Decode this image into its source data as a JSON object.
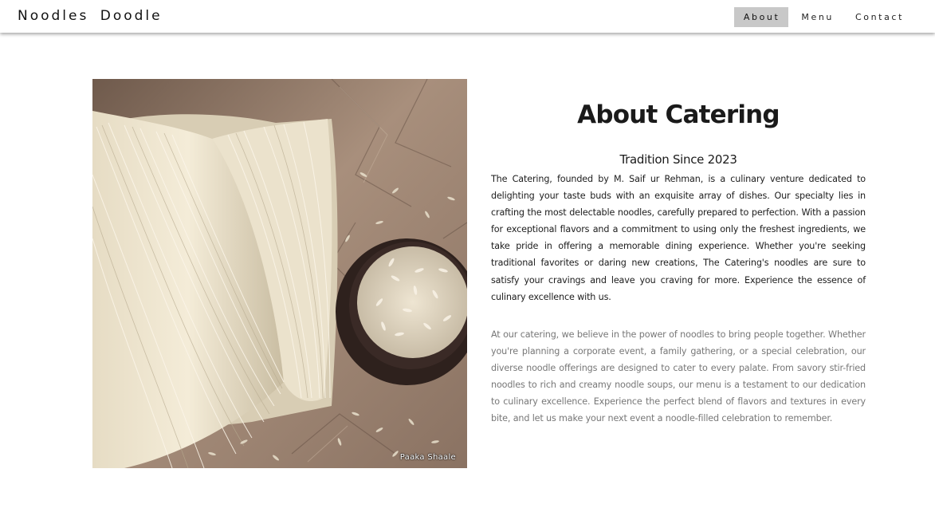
{
  "header": {
    "brand": "Noodles Doodle",
    "nav": [
      {
        "label": "About",
        "active": true
      },
      {
        "label": "Menu",
        "active": false
      },
      {
        "label": "Contact",
        "active": false
      }
    ]
  },
  "hero_image": {
    "watermark": "Paaka Shaale",
    "subject": "noodles and rice photo"
  },
  "about": {
    "title": "About Catering",
    "subtitle": "Tradition Since 2023",
    "paragraph1": "The Catering, founded by M. Saif ur Rehman, is a culinary venture dedicated to delighting your taste buds with an exquisite array of dishes. Our specialty lies in crafting the most delectable noodles, carefully prepared to perfection. With a passion for exceptional flavors and a commitment to using only the freshest ingredients, we take pride in offering a memorable dining experience. Whether you're seeking traditional favorites or daring new creations, The Catering's noodles are sure to satisfy your cravings and leave you craving for more. Experience the essence of culinary excellence with us.",
    "paragraph2": "At our catering, we believe in the power of noodles to bring people together. Whether you're planning a corporate event, a family gathering, or a special celebration, our diverse noodle offerings are designed to cater to every palate. From savory stir-fried noodles to rich and creamy noodle soups, our menu is a testament to our dedication to culinary excellence. Experience the perfect blend of flavors and textures in every bite, and let us make your next event a noodle-filled celebration to remember."
  },
  "colors": {
    "nav_active_bg": "#c8c8c8",
    "text_primary": "#1c1c1c",
    "text_secondary": "#777777",
    "paper": "#9c8472",
    "bowl": "#3a2a26"
  }
}
